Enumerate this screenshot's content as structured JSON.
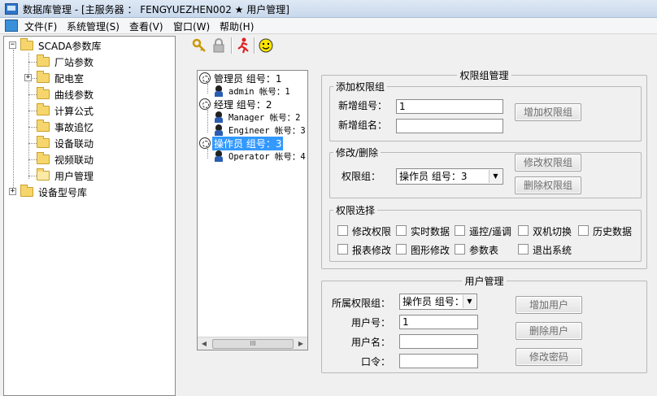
{
  "window": {
    "title": "数据库管理 - [主服务器 ： FENGYUEZHEN002 ★ 用户管理]"
  },
  "menubar": {
    "items": [
      "文件(F)",
      "系统管理(S)",
      "查看(V)",
      "窗口(W)",
      "帮助(H)"
    ]
  },
  "tree": {
    "root": "SCADA参数库",
    "children": [
      "厂站参数",
      "配电室",
      "曲线参数",
      "计算公式",
      "事故追忆",
      "设备联动",
      "视频联动",
      "用户管理"
    ],
    "root2": "设备型号库",
    "expander_collapsed": "+",
    "expander_expanded": "−"
  },
  "toolbar": {
    "icons": [
      "key-icon",
      "lock-icon",
      "run-icon",
      "smiley-icon"
    ]
  },
  "user_tree": {
    "groups": [
      {
        "label": "管理员 组号：1",
        "users": [
          "admin 帐号：1"
        ]
      },
      {
        "label": "经理 组号：2",
        "users": [
          "Manager 帐号：2",
          "Engineer 帐号：3"
        ]
      },
      {
        "label": "操作员 组号：3",
        "users": [
          "Operator 帐号：4"
        ],
        "selected": true
      }
    ],
    "scroll_thumb": "III"
  },
  "perm_group_mgmt": {
    "title": "权限组管理",
    "add": {
      "title": "添加权限组",
      "id_label": "新增组号：",
      "id_value": "1",
      "name_label": "新增组名：",
      "name_value": "",
      "add_button": "增加权限组"
    },
    "modify": {
      "title": "修改/删除",
      "group_label": "权限组：",
      "group_value": "操作员 组号：3",
      "modify_button": "修改权限组",
      "delete_button": "删除权限组"
    },
    "perms": {
      "title": "权限选择",
      "items": [
        "修改权限",
        "实时数据",
        "遥控/遥调",
        "双机切换",
        "历史数据",
        "报表修改",
        "图形修改",
        "参数表",
        "退出系统"
      ]
    }
  },
  "user_mgmt": {
    "title": "用户管理",
    "group_label": "所属权限组：",
    "group_value": "操作员 组号：",
    "user_no_label": "用户号：",
    "user_no_value": "1",
    "user_name_label": "用户名：",
    "user_name_value": "",
    "password_label": "口令：",
    "password_value": "",
    "add_button": "增加用户",
    "delete_button": "删除用户",
    "change_pwd_button": "修改密码"
  }
}
